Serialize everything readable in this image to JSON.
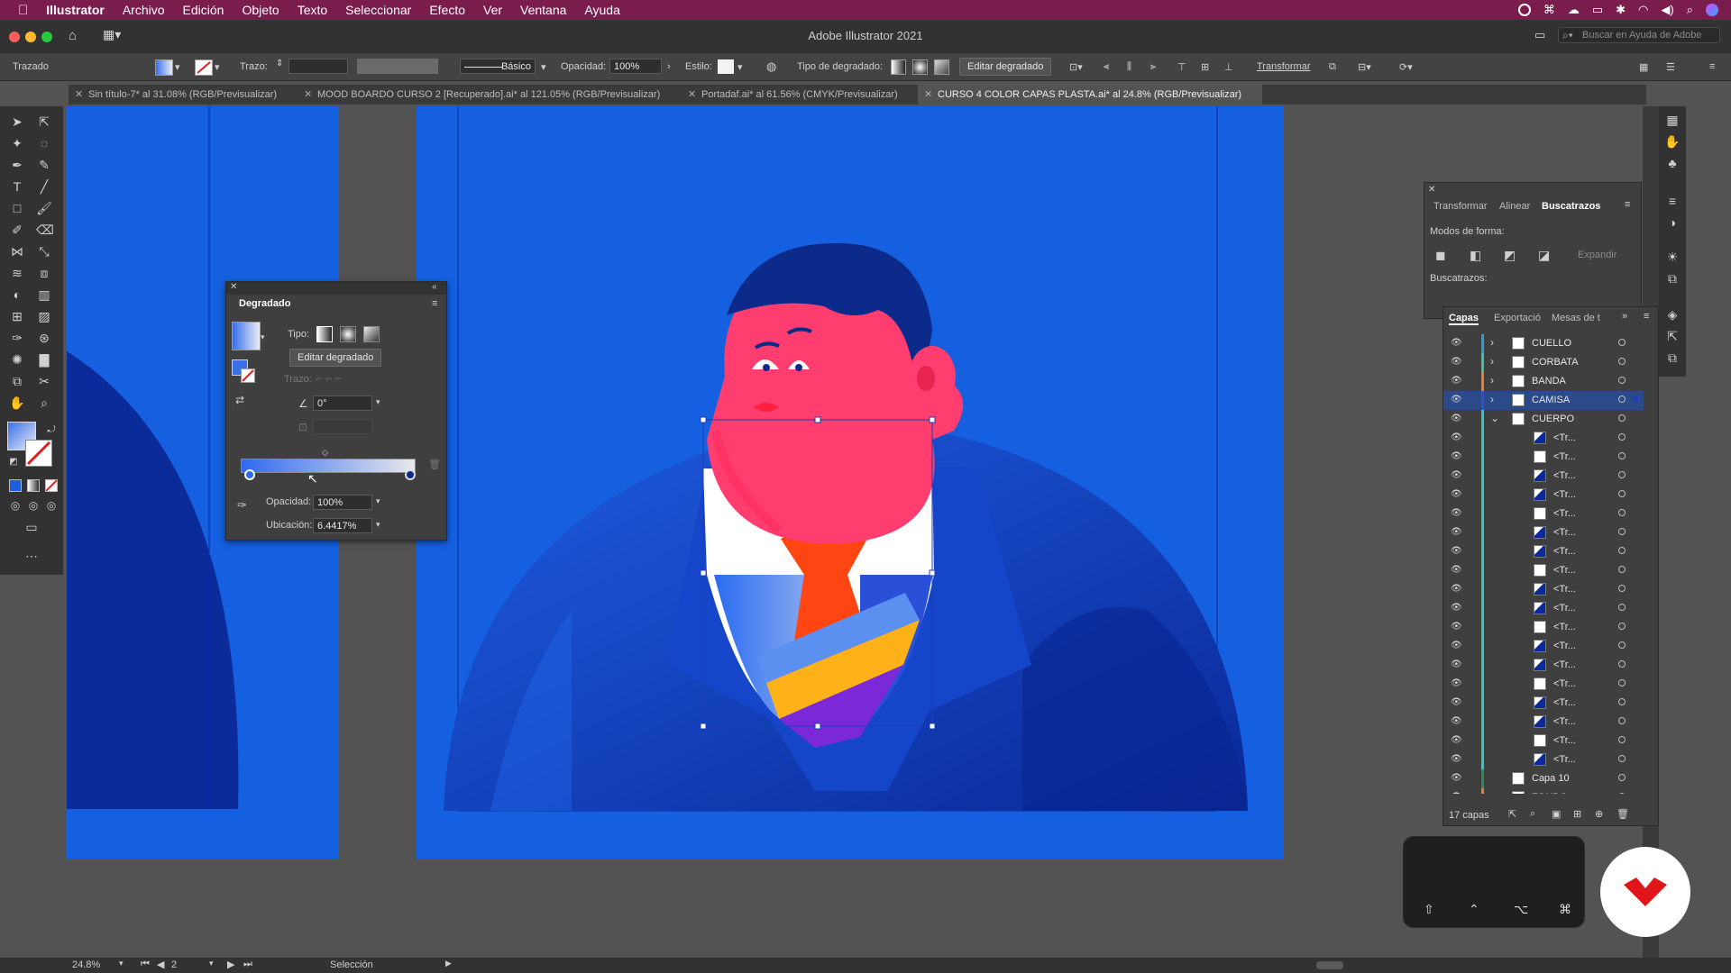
{
  "menubar": {
    "app": "Illustrator",
    "items": [
      "Archivo",
      "Edición",
      "Objeto",
      "Texto",
      "Seleccionar",
      "Efecto",
      "Ver",
      "Ventana",
      "Ayuda"
    ]
  },
  "window": {
    "title": "Adobe Illustrator 2021",
    "search_placeholder": "Buscar en Ayuda de Adobe"
  },
  "control_bar": {
    "selection_label": "Trazado",
    "stroke_label": "Trazo:",
    "brush_label": "Básico",
    "opacity_label": "Opacidad:",
    "opacity_value": "100%",
    "style_label": "Estilo:",
    "gradient_type_label": "Tipo de degradado:",
    "edit_gradient": "Editar degradado",
    "transform": "Transformar"
  },
  "tabs": [
    "Sin título-7* al 31.08% (RGB/Previsualizar)",
    "MOOD BOARDO CURSO 2 [Recuperado].ai* al 121.05% (RGB/Previsualizar)",
    "Portadaf.ai* al 61.56% (CMYK/Previsualizar)",
    "CURSO 4 COLOR CAPAS PLASTA.ai* al 24.8% (RGB/Previsualizar)"
  ],
  "gradient_panel": {
    "title": "Degradado",
    "type_label": "Tipo:",
    "edit_button": "Editar degradado",
    "stroke_label": "Trazo:",
    "angle": "0°",
    "opacity_label": "Opacidad:",
    "opacity_value": "100%",
    "location_label": "Ubicación:",
    "location_value": "6.4417%"
  },
  "pathfinder_panel": {
    "tabs": [
      "Transformar",
      "Alinear",
      "Buscatrazos"
    ],
    "shape_modes": "Modos de forma:",
    "expand": "Expandir",
    "pathfinders": "Buscatrazos:"
  },
  "layers_panel": {
    "tabs": [
      "Capas",
      "Exportació",
      "Mesas de t"
    ],
    "rows": [
      {
        "name": "CUELLO",
        "color": "#2a9fd6"
      },
      {
        "name": "CORBATA",
        "color": "#40c0a0"
      },
      {
        "name": "BANDA",
        "color": "#e87d2a"
      },
      {
        "name": "CAMISA",
        "color": "#3050d0"
      },
      {
        "name": "CUERPO",
        "color": "#30c8c8"
      },
      {
        "name": "<Tr..."
      },
      {
        "name": "<Tr..."
      },
      {
        "name": "<Tr..."
      },
      {
        "name": "<Tr..."
      },
      {
        "name": "<Tr..."
      },
      {
        "name": "<Tr..."
      },
      {
        "name": "<Tr..."
      },
      {
        "name": "<Tr..."
      },
      {
        "name": "<Tr..."
      },
      {
        "name": "<Tr..."
      },
      {
        "name": "<Tr..."
      },
      {
        "name": "<Tr..."
      },
      {
        "name": "<Tr..."
      },
      {
        "name": "<Tr..."
      },
      {
        "name": "<Tr..."
      },
      {
        "name": "<Tr..."
      },
      {
        "name": "<Tr..."
      },
      {
        "name": "<Tr..."
      },
      {
        "name": "Capa 10",
        "color": "#2e8b57"
      },
      {
        "name": "FONDO",
        "color": "#e87d2a"
      }
    ],
    "count": "17 capas"
  },
  "status": {
    "zoom": "24.8%",
    "artboard": "2",
    "tool": "Selección"
  },
  "colors": {
    "bg_blue": "#1560e0",
    "face": "#ff3d6e",
    "hair": "#0b2a8a",
    "tie": "#ff4a10"
  }
}
